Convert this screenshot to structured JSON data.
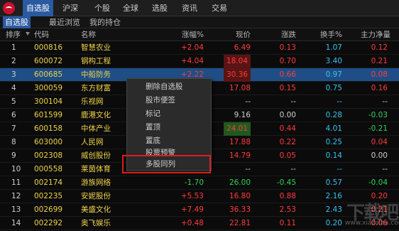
{
  "nav": {
    "items": [
      "自选股",
      "沪深",
      "个股",
      "全球",
      "选股",
      "资讯",
      "交易"
    ]
  },
  "subtabs": [
    "自选股",
    "最近浏览",
    "我的持仓"
  ],
  "columns": {
    "idx": "排序",
    "code": "代码",
    "name": "名称",
    "chg": "涨幅%",
    "price": "现价",
    "delta": "涨跌",
    "turnover": "换手%",
    "flow": "主力净量"
  },
  "rows": [
    {
      "idx": "1",
      "code": "000816",
      "name": "智慧农业",
      "chg": "+2.04",
      "price": "6.49",
      "delta": "0.13",
      "turnover": "1.07",
      "flow": "0.12"
    },
    {
      "idx": "2",
      "code": "600072",
      "name": "钢构工程",
      "chg": "+4.04",
      "price": "18.04",
      "delta": "0.70",
      "turnover": "3.40",
      "flow": "0.21"
    },
    {
      "idx": "3",
      "code": "600685",
      "name": "中船防务",
      "chg": "+2.22",
      "price": "30.36",
      "delta": "0.66",
      "turnover": "0.97",
      "flow": "0.08"
    },
    {
      "idx": "4",
      "code": "300059",
      "name": "东方财富",
      "chg": "+0.89",
      "price": "17.08",
      "delta": "0.15",
      "turnover": "0.75",
      "flow": "0.16"
    },
    {
      "idx": "5",
      "code": "300104",
      "name": "乐视网",
      "chg": "--",
      "price": "--",
      "delta": "--",
      "turnover": "--",
      "flow": "--"
    },
    {
      "idx": "6",
      "code": "601599",
      "name": "鹿港文化",
      "chg": "0.00",
      "price": "9.16",
      "delta": "0.00",
      "turnover": "0.28",
      "flow": "-0.03"
    },
    {
      "idx": "7",
      "code": "600158",
      "name": "中体产业",
      "chg": "+1.87",
      "price": "24.01",
      "delta": "0.44",
      "turnover": "4.01",
      "flow": "-0.21"
    },
    {
      "idx": "8",
      "code": "603000",
      "name": "人民网",
      "chg": "+1.25",
      "price": "17.88",
      "delta": "0.22",
      "turnover": "0.25",
      "flow": "0.04"
    },
    {
      "idx": "9",
      "code": "002308",
      "name": "威创股份",
      "chg": "+0.34",
      "price": "14.79",
      "delta": "0.05",
      "turnover": "0.14",
      "flow": "0.00"
    },
    {
      "idx": "10",
      "code": "000558",
      "name": "莱茵体育",
      "chg": "--",
      "price": "--",
      "delta": "--",
      "turnover": "--",
      "flow": "--"
    },
    {
      "idx": "11",
      "code": "002174",
      "name": "游族网络",
      "chg": "-1.70",
      "price": "26.00",
      "delta": "-0.45",
      "turnover": "0.57",
      "flow": "-0.04"
    },
    {
      "idx": "12",
      "code": "002235",
      "name": "安妮股份",
      "chg": "+5.53",
      "price": "16.80",
      "delta": "0.88",
      "turnover": "2.16",
      "flow": "0.20"
    },
    {
      "idx": "13",
      "code": "002699",
      "name": "美盛文化",
      "chg": "+7.49",
      "price": "36.33",
      "delta": "2.53",
      "turnover": "2.43",
      "flow": "0.21"
    },
    {
      "idx": "14",
      "code": "002292",
      "name": "奥飞娱乐",
      "chg": "+0.48",
      "price": "22.81",
      "delta": "0.11",
      "turnover": "0.20",
      "flow": "0.06"
    }
  ],
  "context_menu": [
    "删除自选股",
    "股市便签",
    "标记",
    "置顶",
    "置底",
    "股票预警",
    "多股同列"
  ],
  "watermark": {
    "text": "下载吧",
    "sub": "www.xiazaiba.com"
  },
  "colors": {
    "up": "#ff3b3b",
    "down": "#2fd35a",
    "code": "#f0d24a",
    "turnover": "#37c3f0",
    "selected": "#1f4e86",
    "highlight": "#e21b1b"
  }
}
